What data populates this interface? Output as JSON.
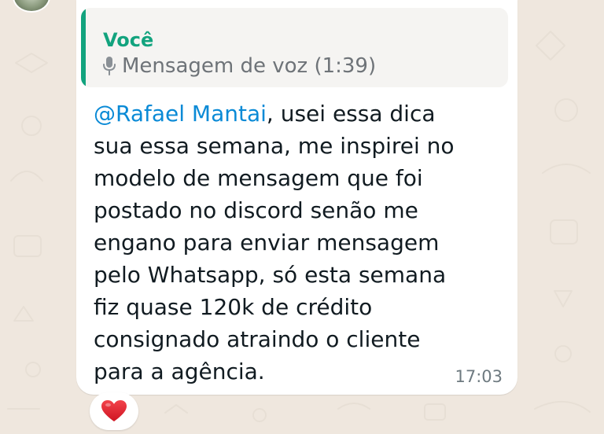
{
  "colors": {
    "chat_background": "#efe7de",
    "bubble_background": "#ffffff",
    "quote_background": "#f5f4f2",
    "accent_green": "#12a37e",
    "mention_blue": "#0a8ad6",
    "text_primary": "#111b21",
    "text_secondary": "#6e7378",
    "reaction_heart": "#e0202a"
  },
  "quoted_message": {
    "author": "Você",
    "icon": "microphone-icon",
    "text": "Mensagem de voz (1:39)"
  },
  "message": {
    "mention": "@Rafael Mantai",
    "lines": [
      ", usei essa dica",
      "sua essa semana, me inspirei no",
      "modelo de mensagem que foi",
      "postado no discord senão me",
      "engano para enviar mensagem",
      "pelo Whatsapp, só esta semana",
      "fiz quase 120k de crédito",
      "consignado atraindo o cliente",
      "para a agência."
    ],
    "time": "17:03"
  },
  "reaction": {
    "icon": "heart-icon"
  }
}
